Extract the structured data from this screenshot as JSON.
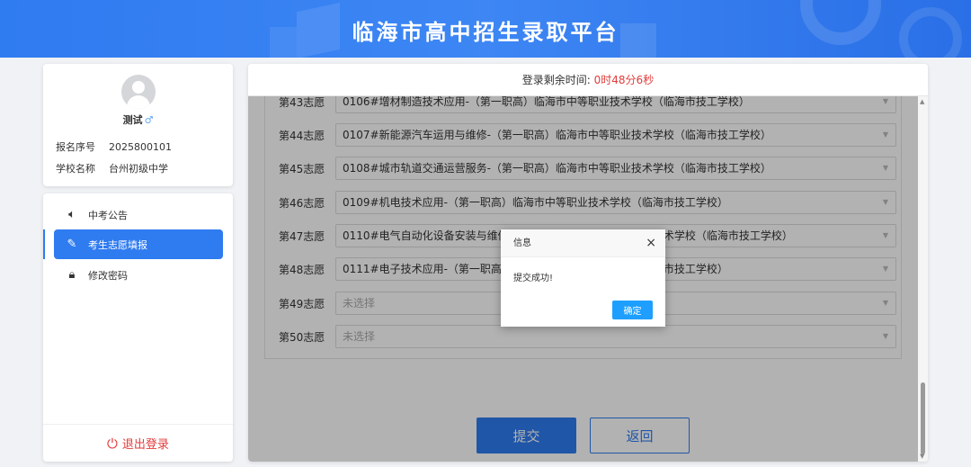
{
  "header": {
    "title": "临海市高中招生录取平台"
  },
  "profile": {
    "name": "测试",
    "gender_icon": "♂",
    "fields": [
      {
        "label": "报名序号",
        "value": "2025800101"
      },
      {
        "label": "学校名称",
        "value": "台州初级中学"
      }
    ]
  },
  "menu": {
    "items": [
      {
        "label": "中考公告",
        "icon": "speaker-icon"
      },
      {
        "label": "考生志愿填报",
        "icon": "edit-form-icon"
      },
      {
        "label": "修改密码",
        "icon": "lock-icon"
      }
    ],
    "logout": "退出登录"
  },
  "timer": {
    "label": "登录剩余时间:",
    "value": "0时48分6秒"
  },
  "choices": [
    {
      "label": "第43志愿",
      "value": "0106#增材制造技术应用-（第一职高）临海市中等职业技术学校（临海市技工学校）"
    },
    {
      "label": "第44志愿",
      "value": "0107#新能源汽车运用与维修-（第一职高）临海市中等职业技术学校（临海市技工学校）"
    },
    {
      "label": "第45志愿",
      "value": "0108#城市轨道交通运营服务-（第一职高）临海市中等职业技术学校（临海市技工学校）"
    },
    {
      "label": "第46志愿",
      "value": "0109#机电技术应用-（第一职高）临海市中等职业技术学校（临海市技工学校）"
    },
    {
      "label": "第47志愿",
      "value": "0110#电气自动化设备安装与维修-（第一职高）临海市中等职业技术学校（临海市技工学校）"
    },
    {
      "label": "第48志愿",
      "value": "0111#电子技术应用-（第一职高）临海市中等职业技术学校（临海市技工学校）"
    },
    {
      "label": "第49志愿",
      "value": "未选择"
    },
    {
      "label": "第50志愿",
      "value": "未选择"
    }
  ],
  "buttons": {
    "submit": "提交",
    "back": "返回"
  },
  "dialog": {
    "title": "信息",
    "message": "提交成功!",
    "ok": "确定",
    "close": "×"
  },
  "colors": {
    "primary": "#2f7bf0",
    "danger": "#e23b3b",
    "dialog_ok": "#1e9fff"
  }
}
